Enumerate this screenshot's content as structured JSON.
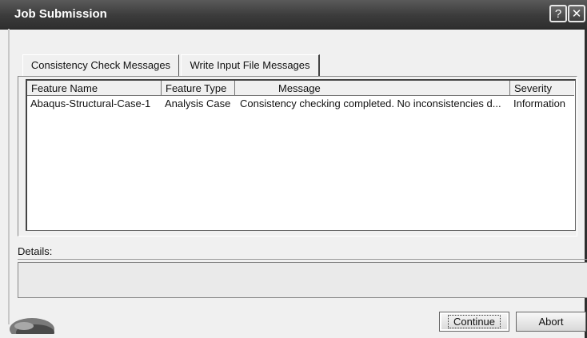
{
  "window": {
    "title": "Job Submission",
    "help_glyph": "?",
    "close_glyph": "✕"
  },
  "tabs": [
    {
      "label": "Consistency Check Messages",
      "active": true
    },
    {
      "label": "Write Input File Messages",
      "active": false
    }
  ],
  "table": {
    "columns": [
      "Feature Name",
      "Feature Type",
      "Message",
      "Severity"
    ],
    "rows": [
      {
        "feature_name": "Abaqus-Structural-Case-1",
        "feature_type": "Analysis Case",
        "message": "Consistency checking completed. No inconsistencies d...",
        "severity": "Information"
      }
    ]
  },
  "details": {
    "label": "Details:",
    "value": ""
  },
  "buttons": {
    "continue": "Continue",
    "abort": "Abort"
  },
  "icons": {
    "help": "help-icon",
    "close": "close-icon",
    "logo": "app-logo-icon"
  }
}
